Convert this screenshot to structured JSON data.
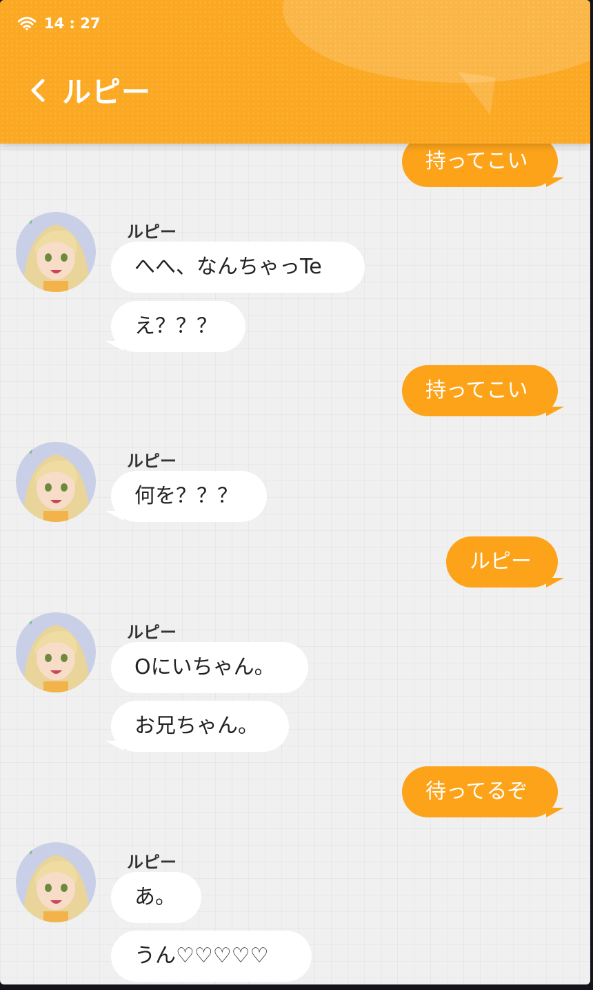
{
  "status": {
    "time": "14 : 27"
  },
  "header": {
    "title": "ルピー"
  },
  "contact": {
    "name": "ルピー"
  },
  "messages": [
    {
      "from": "me",
      "text": "持ってこい"
    },
    {
      "from": "them",
      "text": "へへ、なんちゃっTe"
    },
    {
      "from": "them",
      "text": "え？？？"
    },
    {
      "from": "me",
      "text": "持ってこい"
    },
    {
      "from": "them",
      "text": "何を？？？"
    },
    {
      "from": "me",
      "text": "ルピー"
    },
    {
      "from": "them",
      "text": "Oにいちゃん。"
    },
    {
      "from": "them",
      "text": "お兄ちゃん。"
    },
    {
      "from": "me",
      "text": "待ってるぞ"
    },
    {
      "from": "them",
      "text": "あ。"
    },
    {
      "from": "them",
      "text": "うん♡♡♡♡♡"
    }
  ],
  "colors": {
    "accent": "#fba823",
    "my_bubble": "#fca31a",
    "their_bubble": "#ffffff",
    "background": "#f0f0f0"
  }
}
